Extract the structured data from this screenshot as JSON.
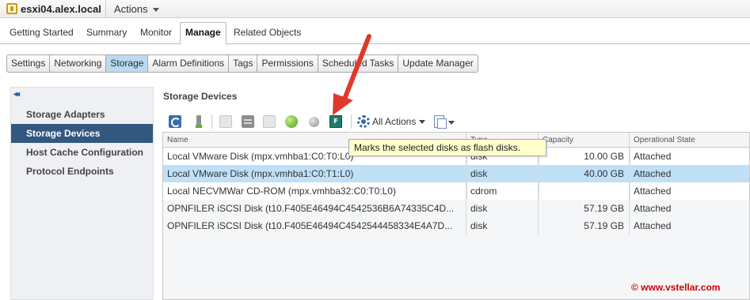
{
  "titlebar": {
    "host_name": "esxi04.alex.local",
    "actions_label": "Actions"
  },
  "main_tabs": [
    {
      "label": "Getting Started",
      "active": false
    },
    {
      "label": "Summary",
      "active": false
    },
    {
      "label": "Monitor",
      "active": false
    },
    {
      "label": "Manage",
      "active": true
    },
    {
      "label": "Related Objects",
      "active": false
    }
  ],
  "sub_tabs": [
    {
      "label": "Settings",
      "active": false
    },
    {
      "label": "Networking",
      "active": false
    },
    {
      "label": "Storage",
      "active": true
    },
    {
      "label": "Alarm Definitions",
      "active": false
    },
    {
      "label": "Tags",
      "active": false
    },
    {
      "label": "Permissions",
      "active": false
    },
    {
      "label": "Scheduled Tasks",
      "active": false
    },
    {
      "label": "Update Manager",
      "active": false
    }
  ],
  "left_nav": {
    "collapse_glyph": "◂◂",
    "items": [
      {
        "label": "Storage Adapters",
        "active": false
      },
      {
        "label": "Storage Devices",
        "active": true
      },
      {
        "label": "Host Cache Configuration",
        "active": false
      },
      {
        "label": "Protocol Endpoints",
        "active": false
      }
    ]
  },
  "panel": {
    "title": "Storage Devices",
    "all_actions_label": "All Actions",
    "flash_icon_glyph": "F"
  },
  "tooltip": {
    "text": "Marks the selected disks as flash disks."
  },
  "table": {
    "columns": [
      "Name",
      "Type",
      "Capacity",
      "Operational State"
    ],
    "rows": [
      {
        "name": "Local VMware Disk (mpx.vmhba1:C0:T0:L0)",
        "type": "disk",
        "capacity": "10.00 GB",
        "state": "Attached",
        "selected": false
      },
      {
        "name": "Local VMware Disk (mpx.vmhba1:C0:T1:L0)",
        "type": "disk",
        "capacity": "40.00 GB",
        "state": "Attached",
        "selected": true
      },
      {
        "name": "Local NECVMWar CD-ROM (mpx.vmhba32:C0:T0:L0)",
        "type": "cdrom",
        "capacity": "",
        "state": "Attached",
        "selected": false
      },
      {
        "name": "OPNFILER iSCSI Disk (t10.F405E46494C4542536B6A74335C4D...",
        "type": "disk",
        "capacity": "57.19 GB",
        "state": "Attached",
        "selected": false
      },
      {
        "name": "OPNFILER iSCSI Disk (t10.F405E46494C4542544458334E4A7D...",
        "type": "disk",
        "capacity": "57.19 GB",
        "state": "Attached",
        "selected": false
      }
    ]
  },
  "watermark": "© www.vstellar.com",
  "colors": {
    "selected_row": "#bfe0f7",
    "nav_active": "#33587f",
    "tooltip_bg": "#ffffcc",
    "arrow": "#e0392b",
    "watermark": "#d40000"
  }
}
